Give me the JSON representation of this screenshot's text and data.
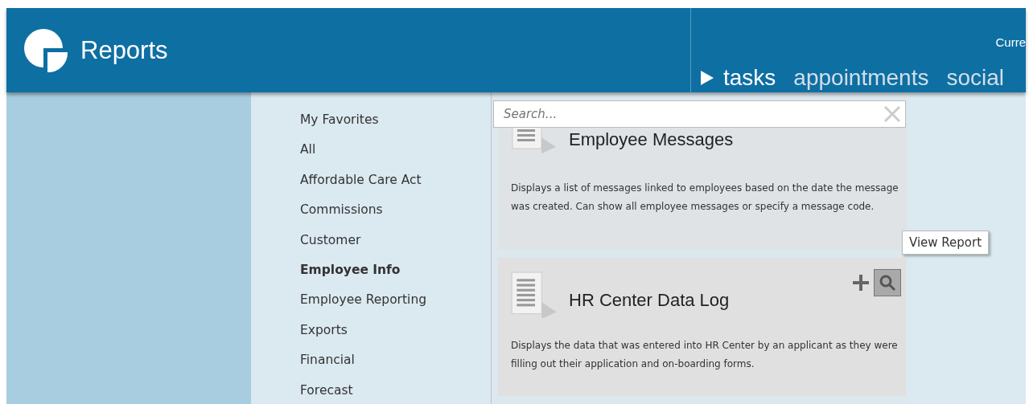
{
  "header": {
    "title": "Reports",
    "user_label": "Curre",
    "tabs": [
      {
        "label": "tasks",
        "selected": true
      },
      {
        "label": "appointments",
        "selected": false
      },
      {
        "label": "social",
        "selected": false
      }
    ]
  },
  "categories": [
    {
      "label": "My Favorites",
      "selected": false
    },
    {
      "label": "All",
      "selected": false
    },
    {
      "label": "Affordable Care Act",
      "selected": false
    },
    {
      "label": "Commissions",
      "selected": false
    },
    {
      "label": "Customer",
      "selected": false
    },
    {
      "label": "Employee Info",
      "selected": true
    },
    {
      "label": "Employee Reporting",
      "selected": false
    },
    {
      "label": "Exports",
      "selected": false
    },
    {
      "label": "Financial",
      "selected": false
    },
    {
      "label": "Forecast",
      "selected": false
    }
  ],
  "search": {
    "placeholder": "Search..."
  },
  "reports": [
    {
      "title": "Employee Messages",
      "description": "Displays a list of messages linked to employees based on the date the message was created.  Can show all employee messages or specify a message code.",
      "hovered": false
    },
    {
      "title": "HR Center Data Log",
      "description": "Displays the data that was entered into HR Center by an applicant as they were filling out their application and on-boarding forms.",
      "hovered": true
    }
  ],
  "tooltip": "View Report"
}
